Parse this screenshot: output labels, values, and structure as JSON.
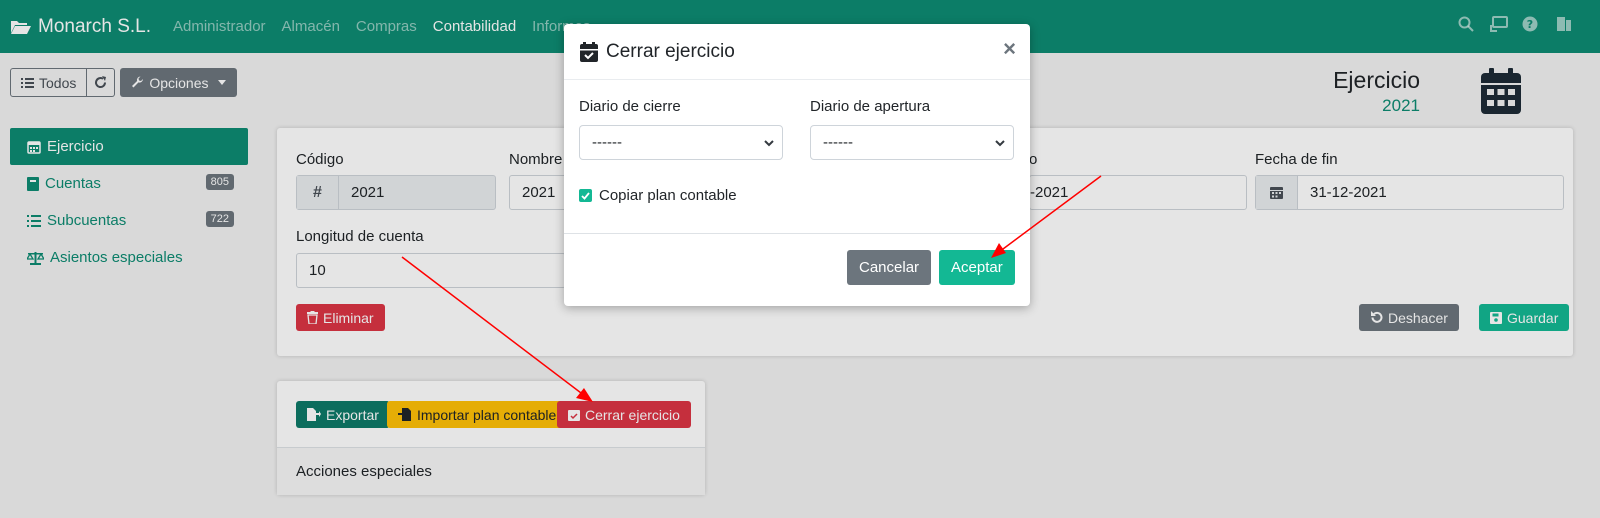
{
  "navbar": {
    "brand": "Monarch S.L.",
    "items": [
      "Administrador",
      "Almacén",
      "Compras",
      "Contabilidad",
      "Informes"
    ],
    "active": "Contabilidad"
  },
  "toolbar": {
    "all_label": "Todos",
    "options_label": "Opciones"
  },
  "page": {
    "title": "Ejercicio",
    "subtitle": "2021"
  },
  "sidebar": {
    "items": [
      {
        "label": "Ejercicio",
        "icon": "calendar-icon"
      },
      {
        "label": "Cuentas",
        "icon": "book-icon",
        "badge": "805"
      },
      {
        "label": "Subcuentas",
        "icon": "list-icon",
        "badge": "722"
      },
      {
        "label": "Asientos especiales",
        "icon": "balance-scale-icon"
      }
    ]
  },
  "form": {
    "codigo_label": "Código",
    "codigo_value": "2021",
    "nombre_label": "Nombre",
    "nombre_value": "2021",
    "fecha_inicio_label": "o",
    "fecha_inicio_value": "-2021",
    "fecha_fin_label": "Fecha de fin",
    "fecha_fin_value": "31-12-2021",
    "longitud_label": "Longitud de cuenta",
    "longitud_value": "10",
    "delete_label": "Eliminar",
    "undo_label": "Deshacer",
    "save_label": "Guardar"
  },
  "actions": {
    "export_label": "Exportar",
    "import_label": "Importar plan contable",
    "close_label": "Cerrar ejercicio",
    "footer_label": "Acciones especiales"
  },
  "modal": {
    "title": "Cerrar ejercicio",
    "close_symbol": "×",
    "diario_cierre_label": "Diario de cierre",
    "diario_cierre_value": "------",
    "diario_apertura_label": "Diario de apertura",
    "diario_apertura_value": "------",
    "copy_label": "Copiar plan contable",
    "copy_checked": true,
    "cancel_label": "Cancelar",
    "accept_label": "Aceptar"
  },
  "colors": {
    "primary": "#0e8c73",
    "success": "#13b894",
    "danger": "#dc3545",
    "warning": "#ffc107",
    "secondary": "#6c757d",
    "arrow": "#ff0000"
  }
}
